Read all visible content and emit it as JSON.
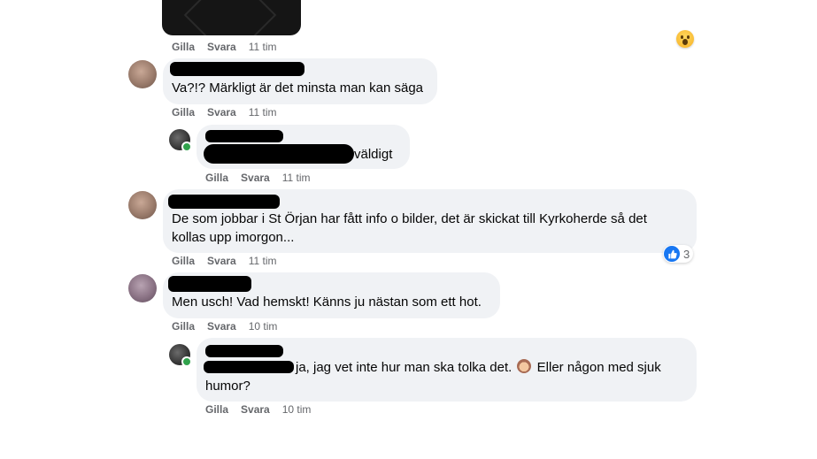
{
  "labels": {
    "like": "Gilla",
    "reply": "Svara"
  },
  "top_action_time": "11 tim",
  "comments": [
    {
      "text": "Va?!? Märkligt är det minsta man kan säga",
      "time": "11 tim"
    },
    {
      "text_visible": "väldigt",
      "time": "11 tim",
      "is_reply": true
    },
    {
      "text_line1": "De som jobbar i St Örjan har fått info o bilder, det är skickat till Kyrkoherde så det",
      "text_line2": "kollas upp imorgon...",
      "time": "11 tim",
      "reaction_count": "3",
      "reaction_type": "like-icon"
    },
    {
      "text": "Men usch! Vad hemskt! Känns ju nästan som ett hot.",
      "time": "10 tim"
    },
    {
      "text_line1": "ja, jag vet inte hur man ska tolka det.",
      "emoji": "facepalm-emoji",
      "text_line1_after": "Eller någon med sjuk",
      "text_line2": "humor?",
      "time": "10 tim",
      "is_reply": true
    }
  ],
  "colors": {
    "bubble": "#f0f2f5",
    "meta": "#65676b",
    "like_blue": "#1877f2",
    "online": "#31a24c"
  }
}
